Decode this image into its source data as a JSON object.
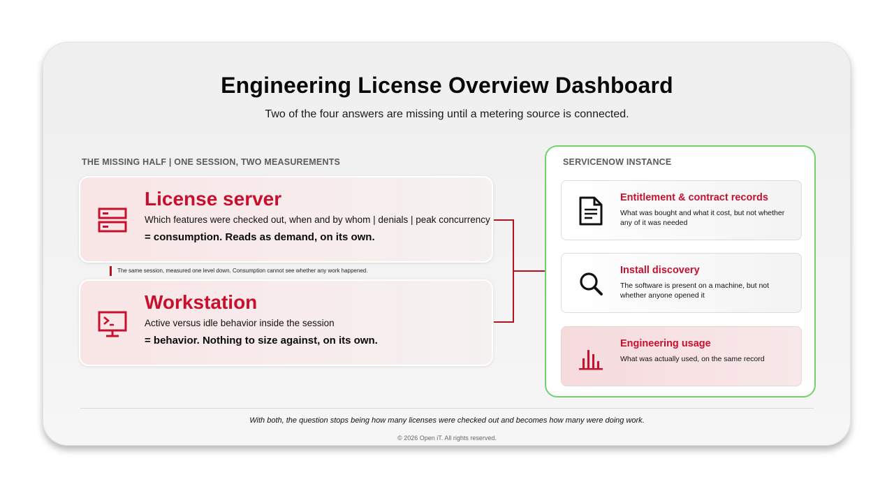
{
  "header": {
    "title": "Engineering License Overview Dashboard",
    "subtitle": "Two of the four answers are missing until a metering source is connected."
  },
  "left_section": {
    "label": "THE MISSING HALF | ONE SESSION, TWO MEASUREMENTS",
    "sources": [
      {
        "name": "License server",
        "description": "Which features were checked out, when and by whom | denials | peak concurrency",
        "result": "= consumption. Reads as demand, on its own.",
        "icon": "server-icon"
      },
      {
        "name": "Workstation",
        "description": "Active versus idle behavior inside the session",
        "result": "= behavior. Nothing to size against, on its own.",
        "icon": "terminal-monitor-icon"
      }
    ],
    "between_note": "The same session, measured one level down. Consumption cannot see whether any work happened."
  },
  "servicenow": {
    "label": "SERVICENOW INSTANCE",
    "records": [
      {
        "title": "Entitlement & contract records",
        "description": "What was bought and what it cost, but not whether any of it was needed",
        "icon": "document-icon"
      },
      {
        "title": "Install discovery",
        "description": "The software is present on a machine, but not whether anyone opened it",
        "icon": "magnifier-icon"
      },
      {
        "title": "Engineering usage",
        "description": "What was actually used, on the same record",
        "icon": "bar-chart-icon"
      }
    ]
  },
  "footer": {
    "note": "With both, the question stops being how many licenses were checked out and becomes how many were doing work.",
    "copyright": "© 2026 Open iT. All rights reserved."
  },
  "colors": {
    "accent_red": "#c8102e",
    "connector_red": "#b5121b",
    "panel_green": "#6fd26a"
  }
}
